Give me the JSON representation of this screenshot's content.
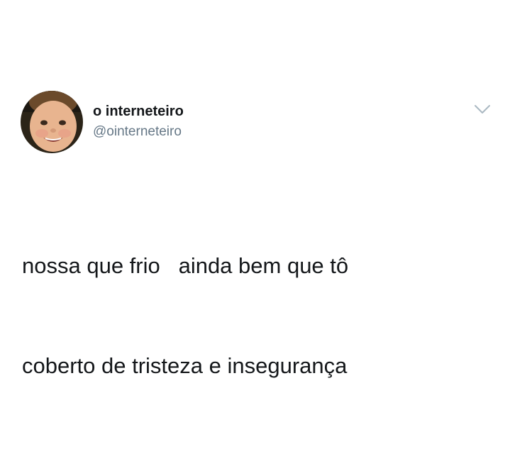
{
  "author": {
    "display_name": "o interneteiro",
    "handle": "@ointerneteiro",
    "avatar": "child-face-photo"
  },
  "menu": {
    "icon": "chevron-down-icon"
  },
  "tweet": {
    "lines": [
      "nossa que frio   ainda bem que tô",
      "coberto de tristeza e insegurança"
    ]
  },
  "colors": {
    "background": "#ffffff",
    "text_primary": "#14171a",
    "text_secondary": "#657786",
    "chevron": "#aab8c2"
  }
}
